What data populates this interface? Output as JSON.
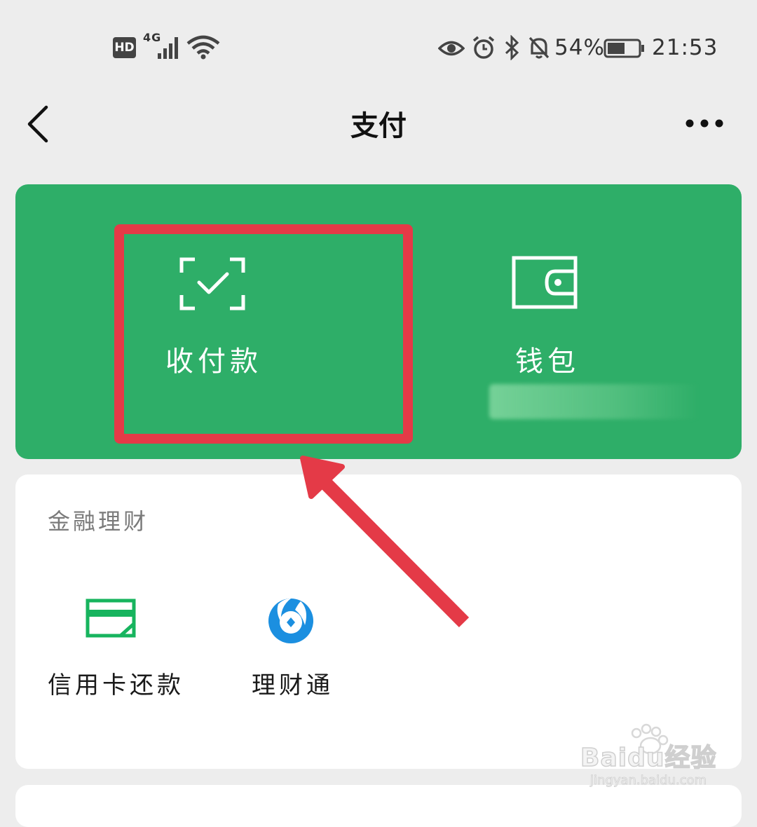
{
  "status_bar": {
    "hd": "HD",
    "network": "4G",
    "battery": "54%",
    "time": "21:53"
  },
  "nav": {
    "title": "支付"
  },
  "top_card": {
    "color": "#2eae68",
    "items": [
      {
        "label": "收付款",
        "icon": "scan-check-icon"
      },
      {
        "label": "钱包",
        "icon": "wallet-icon"
      }
    ]
  },
  "annotation": {
    "color": "#e43a47"
  },
  "finance_section": {
    "title": "金融理财",
    "items": [
      {
        "label": "信用卡还款",
        "icon": "credit-card-icon"
      },
      {
        "label": "理财通",
        "icon": "licaitong-icon"
      }
    ]
  },
  "watermark": {
    "brand": "Baidu经验",
    "url": "jingyan.baidu.com"
  }
}
